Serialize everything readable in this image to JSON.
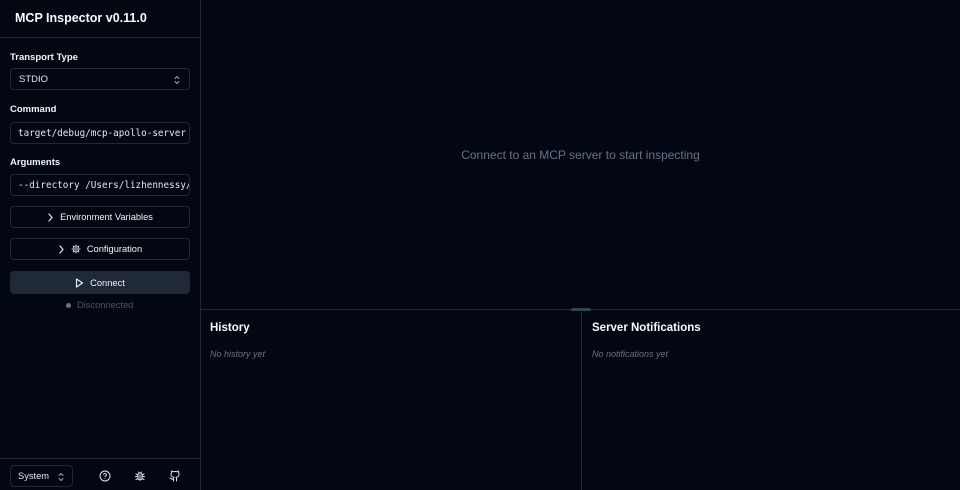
{
  "app": {
    "title": "MCP Inspector v0.11.0"
  },
  "sidebar": {
    "transport": {
      "label": "Transport Type",
      "value": "STDIO"
    },
    "command": {
      "label": "Command",
      "value": "target/debug/mcp-apollo-server"
    },
    "arguments": {
      "label": "Arguments",
      "value": "--directory /Users/lizhennessy/"
    },
    "env_button": "Environment Variables",
    "config_button": "Configuration",
    "connect_button": "Connect",
    "status": "Disconnected",
    "theme": "System"
  },
  "main": {
    "placeholder": "Connect to an MCP server to start inspecting",
    "history": {
      "title": "History",
      "empty": "No history yet"
    },
    "notifications": {
      "title": "Server Notifications",
      "empty": "No notifications yet"
    }
  },
  "icons": {
    "select": "chevrons-up-down-icon",
    "expand": "chevron-right-icon",
    "config": "gear-icon",
    "connect": "play-icon",
    "help": "help-circle-icon",
    "bug": "bug-icon",
    "github": "github-icon"
  },
  "colors": {
    "background": "#030712",
    "border": "#1e293b",
    "connect_bg": "#1f2937"
  }
}
